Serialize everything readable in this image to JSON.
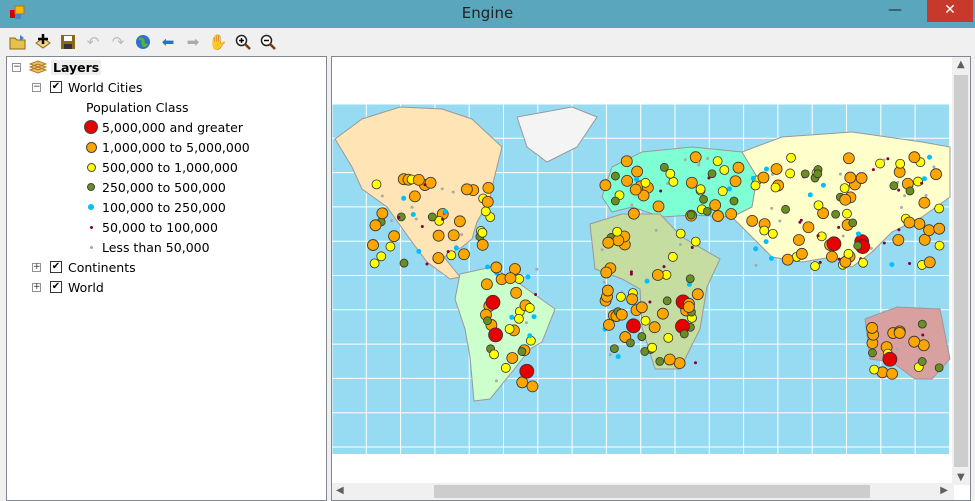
{
  "window": {
    "title": "Engine",
    "minimize": "—",
    "close": "✕"
  },
  "toolbar": {
    "icons": [
      "open-icon",
      "add-data-icon",
      "save-icon",
      "undo-icon",
      "redo-icon",
      "full-extent-globe-icon",
      "back-arrow-icon",
      "forward-arrow-icon",
      "pan-hand-icon",
      "zoom-in-icon",
      "zoom-out-icon"
    ]
  },
  "toc": {
    "root": "Layers",
    "layers": [
      {
        "name": "World Cities",
        "checked": true,
        "expanded": true
      },
      {
        "name": "Continents",
        "checked": true,
        "expanded": false
      },
      {
        "name": "World",
        "checked": true,
        "expanded": false
      }
    ],
    "legend_heading": "Population Class",
    "legend": [
      {
        "label": "5,000,000 and greater",
        "color": "#e60000"
      },
      {
        "label": "1,000,000 to 5,000,000",
        "color": "#ffa500"
      },
      {
        "label": "500,000 to 1,000,000",
        "color": "#ffff00"
      },
      {
        "label": "250,000 to 500,000",
        "color": "#6b8e23"
      },
      {
        "label": "100,000 to 250,000",
        "color": "#00bfff"
      },
      {
        "label": "50,000 to 100,000",
        "color": "#800040"
      },
      {
        "label": "Less than 50,000",
        "color": "#a9a9a9"
      }
    ]
  },
  "map": {
    "ocean_color": "#97dbf2"
  }
}
